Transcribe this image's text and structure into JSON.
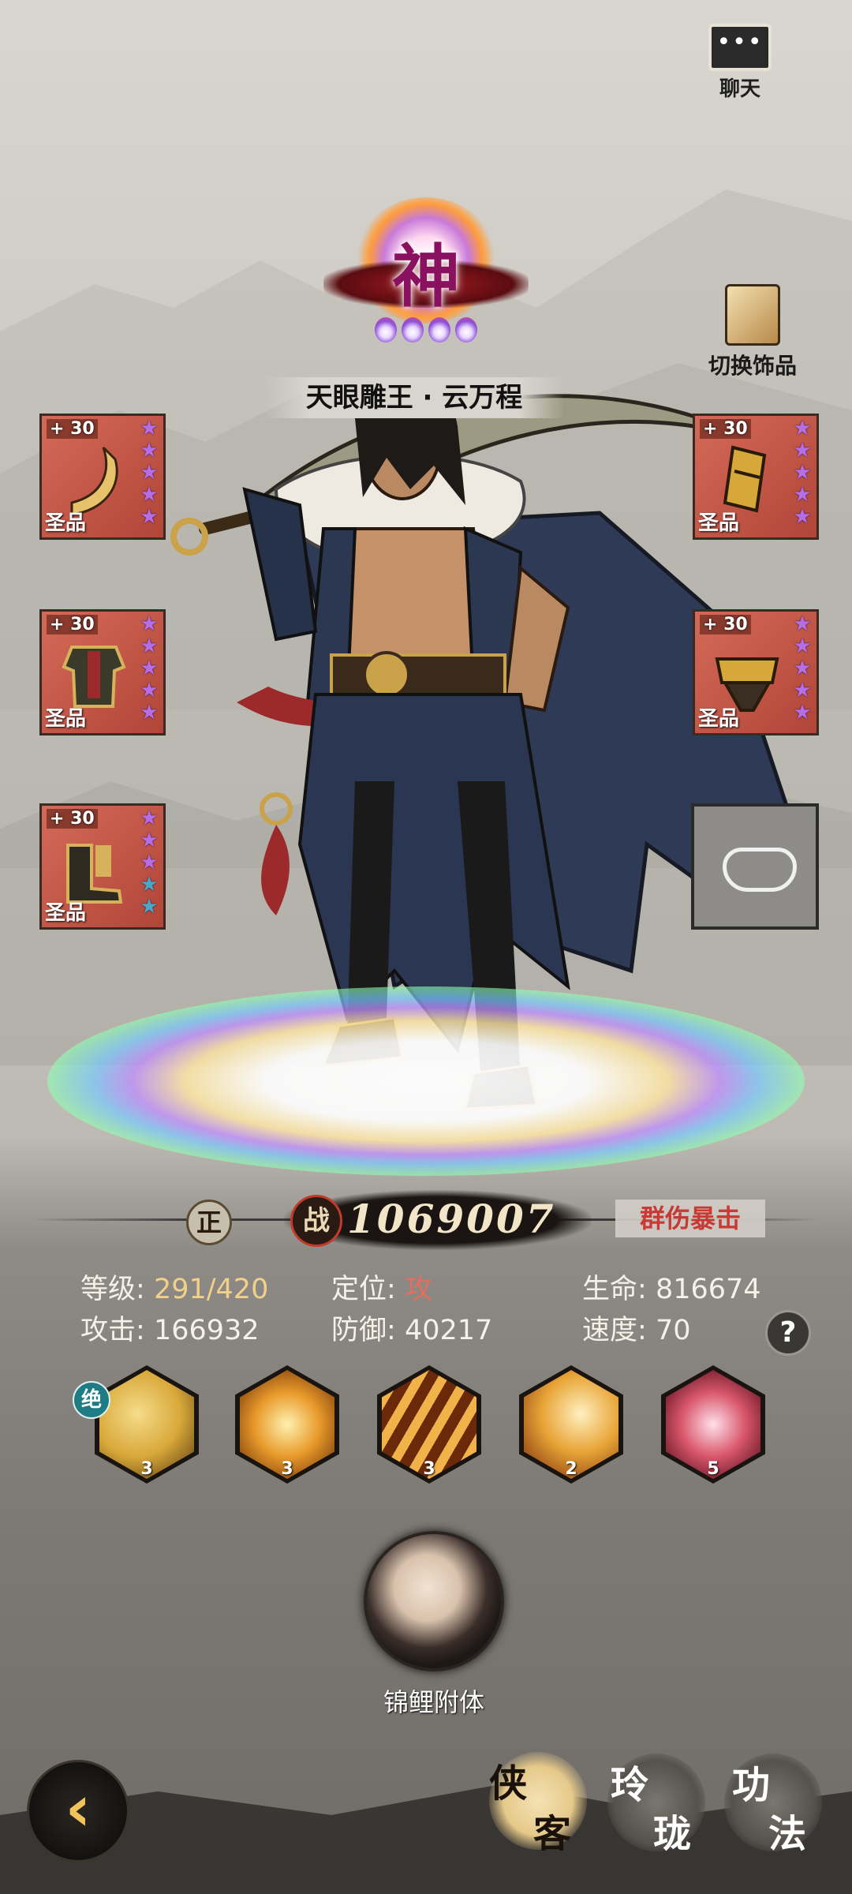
{
  "chat": {
    "icon": "speech-bubble-icon",
    "label": "聊天"
  },
  "switch_ornament": {
    "icon": "ornament-card-icon",
    "label": "切换饰品"
  },
  "rank": {
    "glyph": "神",
    "stars": 4
  },
  "hero": {
    "name": "天眼雕王 · 云万程"
  },
  "equipment": {
    "left": [
      {
        "plus": "+ 30",
        "tag": "圣品",
        "icon": "weapon-icon",
        "stars": [
          "purple",
          "purple",
          "purple",
          "purple",
          "purple"
        ]
      },
      {
        "plus": "+ 30",
        "tag": "圣品",
        "icon": "armor-icon",
        "stars": [
          "purple",
          "purple",
          "purple",
          "purple",
          "purple"
        ]
      },
      {
        "plus": "+ 30",
        "tag": "圣品",
        "icon": "boots-icon",
        "stars": [
          "purple",
          "purple",
          "purple",
          "blue",
          "blue"
        ]
      }
    ],
    "right": [
      {
        "plus": "+ 30",
        "tag": "圣品",
        "icon": "bracer-icon",
        "stars": [
          "purple",
          "purple",
          "purple",
          "purple",
          "purple"
        ]
      },
      {
        "plus": "+ 30",
        "tag": "圣品",
        "icon": "belt-icon",
        "stars": [
          "purple",
          "purple",
          "purple",
          "purple",
          "purple"
        ]
      }
    ],
    "empty_slot_icon": "accessory-slot-icon"
  },
  "power": {
    "side": "正",
    "zhan": "战",
    "value": "1069007",
    "trait": "群伤暴击"
  },
  "stats": {
    "level_label": "等级:",
    "level_value": "291/420",
    "role_label": "定位:",
    "role_value": "攻",
    "hp_label": "生命:",
    "hp_value": "816674",
    "atk_label": "攻击:",
    "atk_value": "166932",
    "def_label": "防御:",
    "def_value": "40217",
    "spd_label": "速度:",
    "spd_value": "70",
    "help": "?"
  },
  "skills": {
    "ultimate_badge": "绝",
    "items": [
      {
        "icon": "beast-skill-icon",
        "level": "3",
        "color": "#d8a83a"
      },
      {
        "icon": "flame-burst-skill-icon",
        "level": "3",
        "color": "#e89a2a"
      },
      {
        "icon": "claw-slash-skill-icon",
        "level": "3",
        "color": "#e0962c"
      },
      {
        "icon": "swirl-skill-icon",
        "level": "2",
        "color": "#e8a436"
      },
      {
        "icon": "pink-vortex-skill-icon",
        "level": "5",
        "color": "#d8566a"
      }
    ]
  },
  "companion": {
    "label": "锦鲤附体"
  },
  "nav": {
    "back_icon": "back-arrow-icon",
    "xiake": [
      "侠",
      "客"
    ],
    "linglong": [
      "玲",
      "珑"
    ],
    "gongfa": [
      "功",
      "法"
    ]
  }
}
